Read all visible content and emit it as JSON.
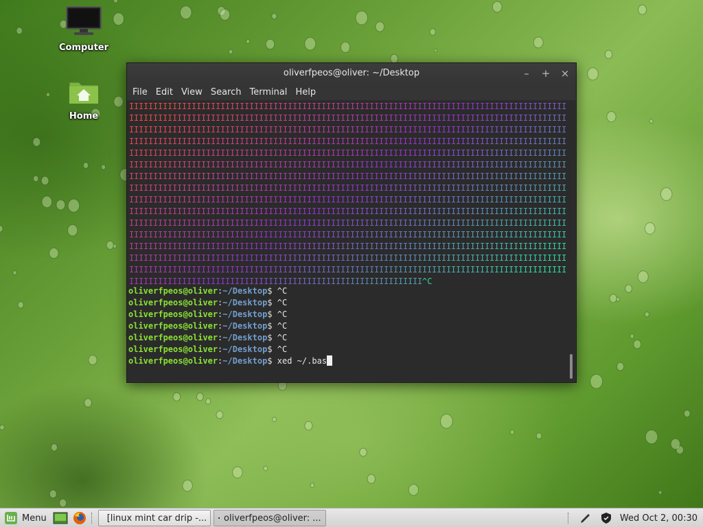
{
  "desktop": {
    "icons": [
      {
        "label": "Computer",
        "icon": "monitor-icon"
      },
      {
        "label": "Home",
        "icon": "home-folder-icon"
      }
    ]
  },
  "terminal": {
    "title": "oliverfpeos@oliver: ~/Desktop",
    "menu": [
      "File",
      "Edit",
      "View",
      "Search",
      "Terminal",
      "Help"
    ],
    "colors": {
      "rainbow_start": "#e24a4a",
      "rainbow_mid": "#8f35c7",
      "rainbow_end": "#2fd6a0",
      "prompt_user": "#8ae234",
      "prompt_path": "#729fcf"
    },
    "rainbow_glyph": "I",
    "rainbow_tail": "^C",
    "prompt": {
      "user_host": "oliverfpeos@oliver",
      "sep": ":",
      "path": "~/Desktop",
      "dollar": "$"
    },
    "history": [
      {
        "cmd": " ^C"
      },
      {
        "cmd": " ^C"
      },
      {
        "cmd": " ^C"
      },
      {
        "cmd": " ^C"
      },
      {
        "cmd": " ^C"
      },
      {
        "cmd": " ^C"
      },
      {
        "cmd": " xed ~/.bas"
      }
    ]
  },
  "taskbar": {
    "menu_label": "Menu",
    "windows": [
      {
        "label": "[linux mint car drip -...",
        "icon": "image-viewer-icon",
        "active": false
      },
      {
        "label": "oliverfpeos@oliver: ...",
        "icon": "terminal-icon",
        "active": true
      }
    ],
    "clock": "Wed Oct  2, 00:30"
  }
}
